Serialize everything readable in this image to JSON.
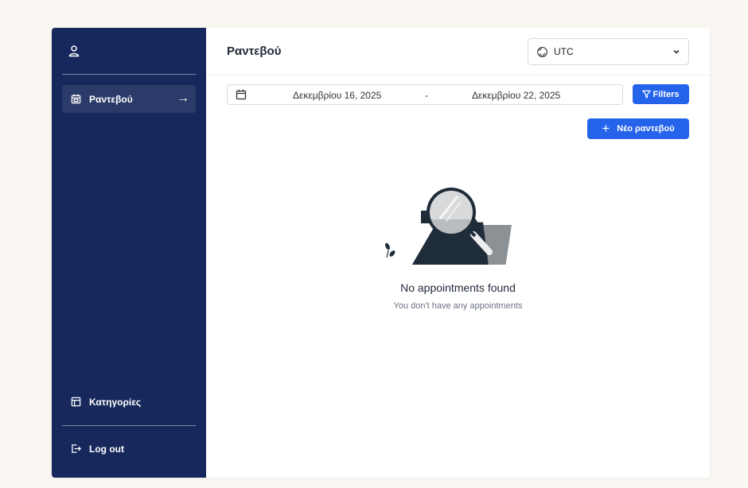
{
  "sidebar": {
    "items": [
      {
        "label": "Ραντεβού",
        "icon": "calendar-icon",
        "active": true
      },
      {
        "label": "Κατηγορίες",
        "icon": "categories-icon",
        "active": false
      }
    ],
    "logout_label": "Log out",
    "user_icon": "user-icon",
    "background": "#17295c"
  },
  "header": {
    "title": "Ραντεβού",
    "timezone": {
      "value": "UTC",
      "icon": "globe-icon"
    }
  },
  "toolbar": {
    "date_range": {
      "start": "Δεκεμβρίου 16, 2025",
      "separator": "-",
      "end": "Δεκεμβρίου 22, 2025"
    },
    "filters_label": "Filters",
    "new_label": "Νέο ραντεβού",
    "accent": "#2563eb"
  },
  "empty_state": {
    "title": "No appointments found",
    "subtitle": "You don't have any appointments",
    "illustration": "folder-magnifier-illustration"
  }
}
